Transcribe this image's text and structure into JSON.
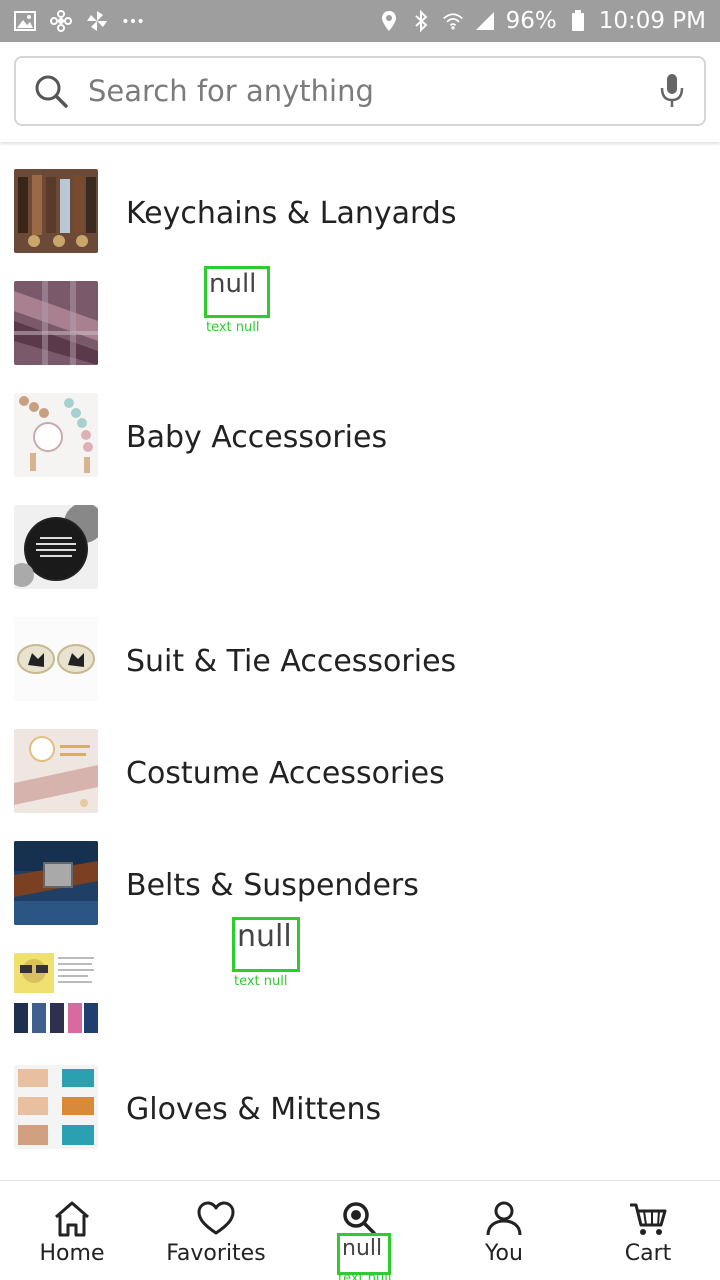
{
  "status_bar": {
    "battery": "96%",
    "time": "10:09 PM",
    "left_icons": [
      "image-icon",
      "pinwheel-icon",
      "pinwheel-icon",
      "more-icon"
    ],
    "right_icons": [
      "location-icon",
      "bluetooth-icon",
      "wifi-icon",
      "signal-icon",
      "battery-icon"
    ]
  },
  "search": {
    "placeholder": "Search for anything"
  },
  "categories": [
    {
      "label": "Keychains & Lanyards"
    },
    {
      "label": "null",
      "null_tag": "text null"
    },
    {
      "label": "Baby Accessories"
    },
    {
      "label": ""
    },
    {
      "label": "Suit & Tie Accessories"
    },
    {
      "label": "Costume Accessories"
    },
    {
      "label": "Belts & Suspenders"
    },
    {
      "label": "null",
      "null_tag": "text null"
    },
    {
      "label": "Gloves & Mittens"
    }
  ],
  "bottom_nav": {
    "home": "Home",
    "favorites": "Favorites",
    "search": "null",
    "search_tag": "text null",
    "you": "You",
    "cart": "Cart"
  },
  "colors": {
    "status_bar": "#9e9e9e",
    "annotation_green": "#2ecc2e"
  }
}
